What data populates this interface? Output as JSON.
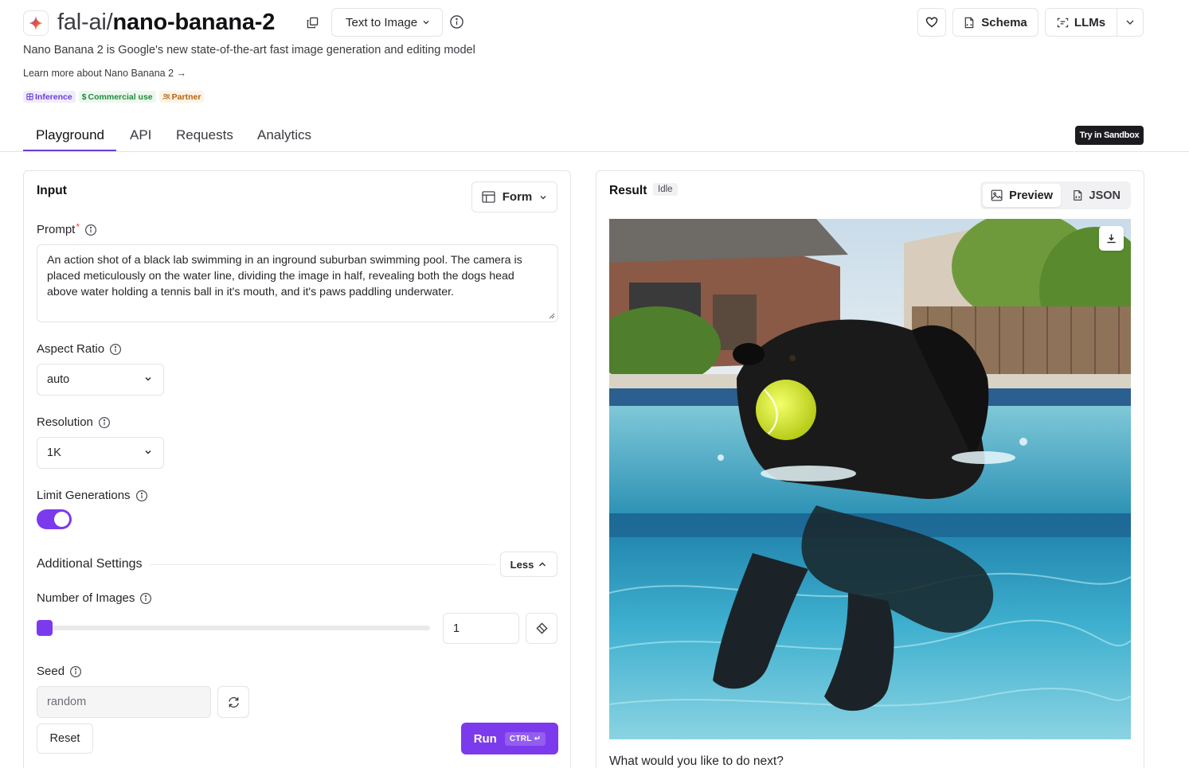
{
  "header": {
    "org": "fal-ai/",
    "model": "nano-banana-2",
    "mode_select": "Text to Image",
    "schema_label": "Schema",
    "llms_label": "LLMs",
    "description": "Nano Banana 2 is Google's new state-of-the-art fast image generation and editing model",
    "learn_more": "Learn more about Nano Banana 2 →",
    "badges": [
      "Inference",
      "Commercial use",
      "Partner"
    ]
  },
  "tabs": [
    "Playground",
    "API",
    "Requests",
    "Analytics"
  ],
  "active_tab": "Playground",
  "sandbox_label": "Try in Sandbox",
  "input": {
    "title": "Input",
    "view_mode": "Form",
    "prompt_label": "Prompt",
    "prompt_required": "*",
    "prompt_value": "An action shot of a black lab swimming in an inground suburban swimming pool. The camera is placed meticulously on the water line, dividing the image in half, revealing both the dogs head above water holding a tennis ball in it's mouth, and it's paws paddling underwater.",
    "aspect_ratio_label": "Aspect Ratio",
    "aspect_ratio_value": "auto",
    "resolution_label": "Resolution",
    "resolution_value": "1K",
    "limit_generations_label": "Limit Generations",
    "limit_generations_on": true,
    "additional_settings_label": "Additional Settings",
    "less_label": "Less",
    "num_images_label": "Number of Images",
    "num_images_value": "1",
    "seed_label": "Seed",
    "seed_placeholder": "random",
    "reset_label": "Reset",
    "run_label": "Run",
    "run_shortcut": "CTRL ↵"
  },
  "result": {
    "title": "Result",
    "status": "Idle",
    "preview_label": "Preview",
    "json_label": "JSON",
    "next_prompt": "What would you like to do next?"
  },
  "colors": {
    "accent": "#7c3aed",
    "tab_underline": "#6b3fd6",
    "sandbox_bg": "#1c1c20"
  }
}
